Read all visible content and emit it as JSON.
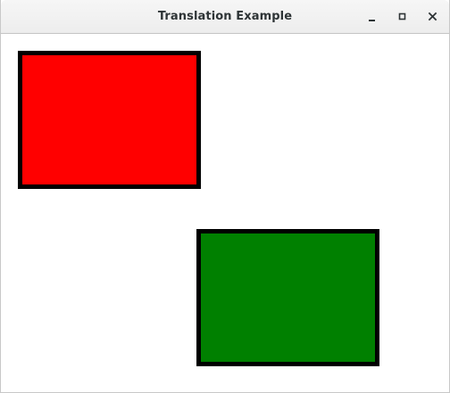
{
  "window": {
    "title": "Translation Example",
    "controls": {
      "minimize_icon": "minimize-icon",
      "maximize_icon": "maximize-icon",
      "close_icon": "close-icon"
    }
  },
  "canvas": {
    "background": "#ffffff",
    "shapes": [
      {
        "name": "red-rectangle",
        "fill": "#ff0000",
        "stroke": "#000000"
      },
      {
        "name": "green-rectangle",
        "fill": "#008000",
        "stroke": "#000000"
      }
    ]
  }
}
